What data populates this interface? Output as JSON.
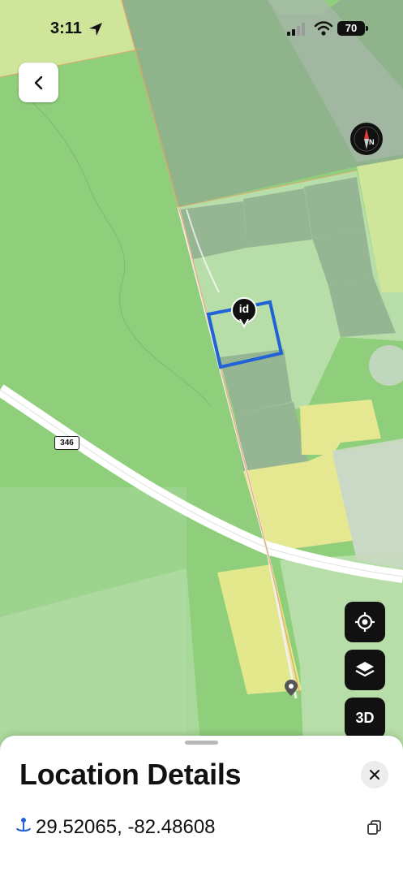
{
  "status_bar": {
    "time": "3:11",
    "battery": "70"
  },
  "map": {
    "road_label": "346",
    "pin_label": "id"
  },
  "controls": {
    "three_d_label": "3D"
  },
  "sheet": {
    "title": "Location Details",
    "coordinates": "29.52065, -82.48608"
  },
  "icons": [
    "back-arrow-icon",
    "compass-icon",
    "locate-icon",
    "layers-icon",
    "close-icon",
    "copy-icon",
    "location-pin-icon",
    "signal-icon",
    "wifi-icon",
    "battery-icon"
  ]
}
